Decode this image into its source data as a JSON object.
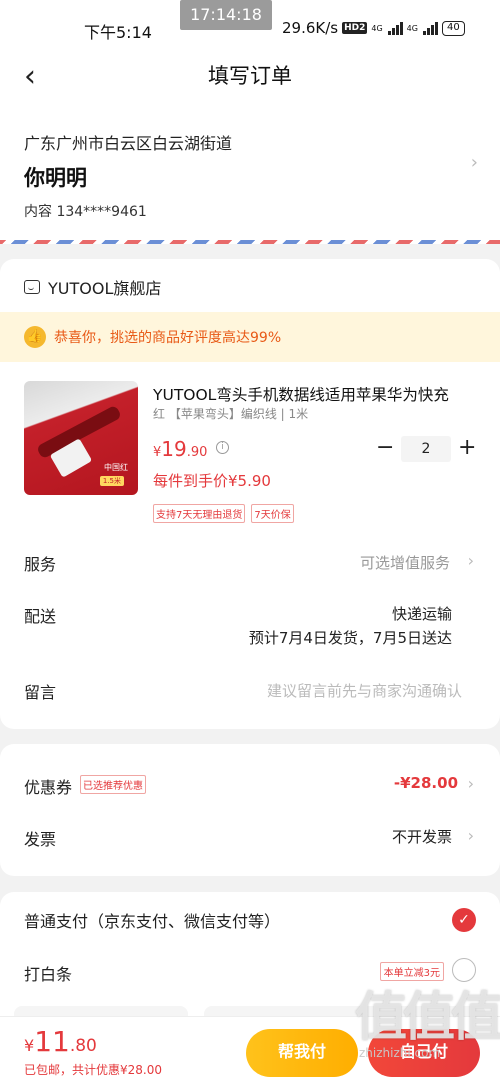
{
  "status_bar": {
    "time": "下午5:14",
    "clock_overlay": "17:14:18",
    "net_speed": "29.6K/s",
    "hd_badge": "HD2",
    "signal1_label": "4G",
    "signal2_label": "4G",
    "battery": "40"
  },
  "nav": {
    "back_icon": "chevron-left-icon",
    "title": "填写订单"
  },
  "address": {
    "line": "广东广州市白云区白云湖街道",
    "name": "你明明",
    "phone": "内容  134****9461"
  },
  "store": {
    "name": "YUTOOL旗舰店",
    "praise": "恭喜你，挑选的商品好评度高达99%"
  },
  "product": {
    "title": "YUTOOL弯头手机数据线适用苹果华为快充",
    "spec": "红 【苹果弯头】编织线 | 1米",
    "image_badge": "中国红",
    "image_badge2": "1.5米",
    "price_currency": "¥",
    "price_int": "19",
    "price_dec": ".90",
    "quantity": "2",
    "unit_price": "每件到手价¥5.90",
    "tags": [
      "支持7天无理由退货",
      "7天价保"
    ]
  },
  "rows": {
    "service_label": "服务",
    "service_value": "可选增值服务",
    "delivery_label": "配送",
    "delivery_value": "快递运输",
    "delivery_eta": "预计7月4日发货，7月5日送达",
    "message_label": "留言",
    "message_placeholder": "建议留言前先与商家沟通确认"
  },
  "discounts": {
    "coupon_label": "优惠券",
    "coupon_tag": "已选推荐优惠",
    "coupon_value": "-¥28.00",
    "invoice_label": "发票",
    "invoice_value": "不开发票"
  },
  "payment": {
    "option1": "普通支付（京东支付、微信支付等）",
    "option2": "打白条",
    "option2_promo": "本单立减3元"
  },
  "bottom": {
    "currency": "¥",
    "total_int": "11",
    "total_dec": ".80",
    "summary": "已包邮，共计优惠¥28.00",
    "help_pay": "帮我付",
    "pay": "自己付"
  },
  "watermark": {
    "big": "值值值",
    "small": "zhizhizhi.com"
  },
  "colors": {
    "accent": "#e4393c",
    "help_button": "#ffb400"
  }
}
